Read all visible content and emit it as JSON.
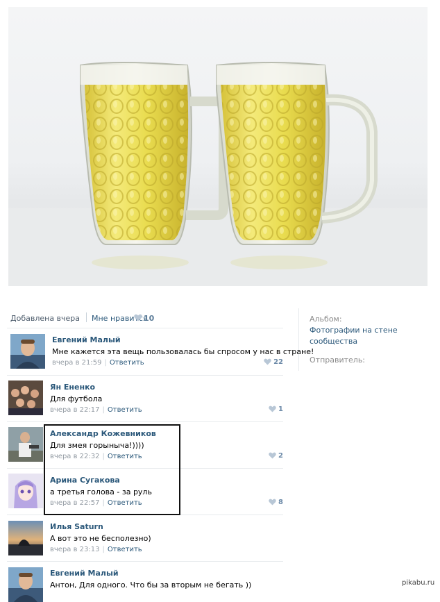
{
  "post": {
    "added": "Добавлена вчера",
    "likes_label": "Мне нравится",
    "likes_count": "10"
  },
  "sidebar": {
    "album_label": "Альбом:",
    "album_name_line1": "Фотографии на стене",
    "album_name_line2": "сообщества",
    "sender_label": "Отправитель:"
  },
  "comments": [
    {
      "author": "Евгений Малый",
      "text": "Мне кажется эта вещь пользовалась бы спросом у нас в стране!",
      "time": "вчера в 21:59",
      "reply": "Ответить",
      "likes": "22"
    },
    {
      "author": "Ян Ененко",
      "text": "Для футбола",
      "time": "вчера в 22:17",
      "reply": "Ответить",
      "likes": "1"
    },
    {
      "author": "Александр Кожевников",
      "text": "Для змея горыныча!))))",
      "time": "вчера в 22:32",
      "reply": "Ответить",
      "likes": "2"
    },
    {
      "author": "Арина Сугакова",
      "text": "а третья голова - за руль",
      "time": "вчера в 22:57",
      "reply": "Ответить",
      "likes": "8"
    },
    {
      "author": "Илья Saturn",
      "text": "А вот это не бесполезно)",
      "time": "вчера в 23:13",
      "reply": "Ответить",
      "likes": ""
    },
    {
      "author": "Евгений Малый",
      "text": "Антон, Для одного. Что бы за вторым не бегать ))",
      "time": "",
      "reply": "",
      "likes": ""
    }
  ],
  "watermark": "pikabu.ru",
  "colors": {
    "link": "#2b587a",
    "meta": "#939ba3",
    "beer": "#e8d64a"
  }
}
